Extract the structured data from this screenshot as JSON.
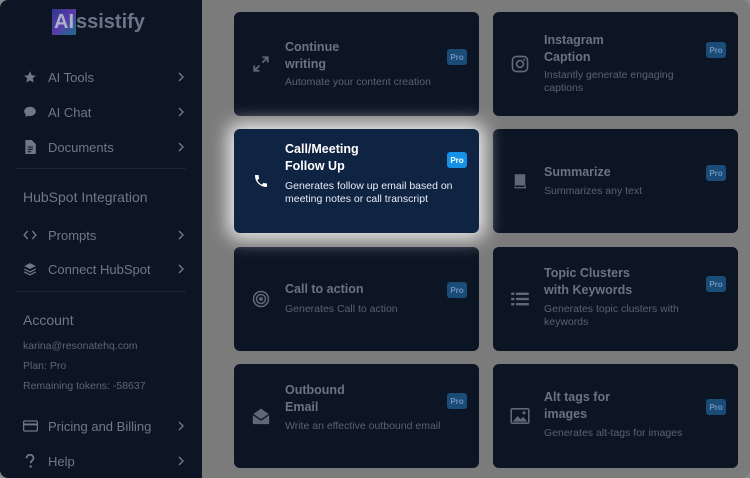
{
  "logo": {
    "ai": "AI",
    "rest": "ssistify"
  },
  "sidebar": {
    "items_top": [
      {
        "label": "AI Tools",
        "icon": "star-icon"
      },
      {
        "label": "AI Chat",
        "icon": "chat-icon"
      },
      {
        "label": "Documents",
        "icon": "document-icon"
      }
    ],
    "hubspot_title": "HubSpot Integration",
    "items_hubspot": [
      {
        "label": "Prompts",
        "icon": "code-icon"
      },
      {
        "label": "Connect HubSpot",
        "icon": "layers-icon"
      }
    ],
    "account_title": "Account",
    "account": {
      "email": "karina@resonatehq.com",
      "plan": "Plan: Pro",
      "tokens": "Remaining tokens: -58637"
    },
    "items_bottom": [
      {
        "label": "Pricing and Billing",
        "icon": "credit-card-icon"
      },
      {
        "label": "Help",
        "icon": "question-icon"
      }
    ]
  },
  "cards": [
    {
      "title": "Continue writing",
      "title_lines": [
        "Continue",
        "writing"
      ],
      "desc": "Automate your content creation",
      "icon": "expand-arrows-icon",
      "badge": "Pro"
    },
    {
      "title": "Instagram Caption",
      "title_lines": [
        "Instagram",
        "Caption"
      ],
      "desc": "Instantly generate engaging captions",
      "icon": "instagram-icon",
      "badge": "Pro"
    },
    {
      "title": "Call/Meeting Follow Up",
      "title_lines": [
        "Call/Meeting",
        "Follow Up"
      ],
      "desc": "Generates follow up email based on meeting notes or call transcript",
      "icon": "phone-icon",
      "badge": "Pro"
    },
    {
      "title": "Summarize",
      "title_lines": [
        "Summarize"
      ],
      "desc": "Summarizes any text",
      "icon": "book-icon",
      "badge": "Pro"
    },
    {
      "title": "Call to action",
      "title_lines": [
        "Call to action"
      ],
      "desc": "Generates Call to action",
      "icon": "target-icon",
      "badge": "Pro"
    },
    {
      "title": "Topic Clusters with Keywords",
      "title_lines": [
        "Topic Clusters",
        "with Keywords"
      ],
      "desc": "Generates topic clusters with keywords",
      "icon": "list-icon",
      "badge": "Pro"
    },
    {
      "title": "Outbound Email",
      "title_lines": [
        "Outbound",
        "Email"
      ],
      "desc": "Write an effective outbound email",
      "icon": "envelope-open-icon",
      "badge": "Pro"
    },
    {
      "title": "Alt tags for images",
      "title_lines": [
        "Alt tags for",
        "images"
      ],
      "desc": "Generates alt-tags for images",
      "icon": "image-icon",
      "badge": "Pro"
    }
  ]
}
